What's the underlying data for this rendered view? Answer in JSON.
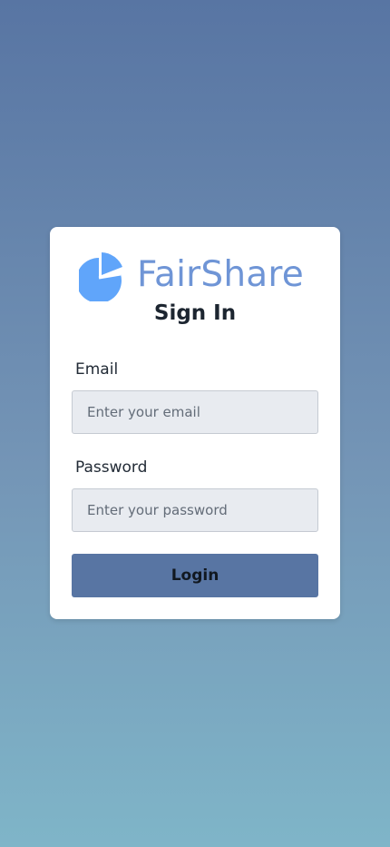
{
  "brand": {
    "name": "FairShare",
    "logo_icon": "pie-chart-icon",
    "color": "#6f95d6",
    "icon_color": "#60a5fa"
  },
  "form": {
    "title": "Sign In",
    "email": {
      "label": "Email",
      "placeholder": "Enter your email",
      "value": ""
    },
    "password": {
      "label": "Password",
      "placeholder": "Enter your password",
      "value": ""
    },
    "submit_label": "Login"
  },
  "colors": {
    "background_top": "#5875a3",
    "background_bottom": "#7fb5c8",
    "button": "#5875a3",
    "input_background": "#e8ebf0",
    "card": "#ffffff"
  }
}
